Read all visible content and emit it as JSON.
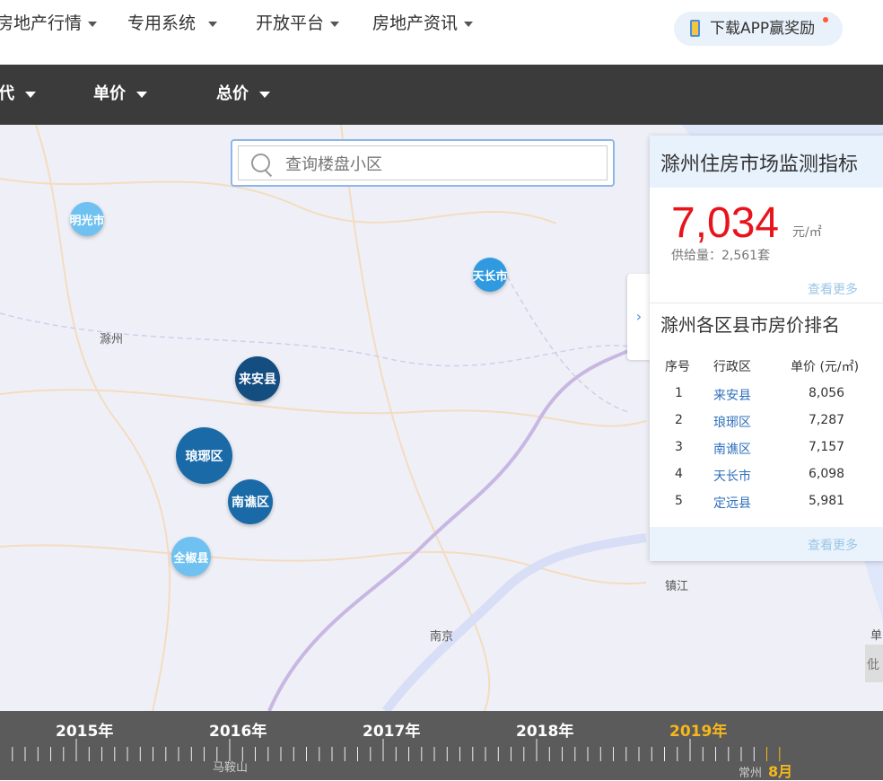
{
  "nav": {
    "items": [
      "房地产行情",
      "专用系统",
      "开放平台",
      "房地产资讯"
    ],
    "app_button": "下载APP赢奖励"
  },
  "filters": [
    "代",
    "单价",
    "总价"
  ],
  "search": {
    "placeholder": "查询楼盘小区"
  },
  "map": {
    "place_labels": [
      "滁州",
      "南京",
      "镇江",
      "马鞍山",
      "常州",
      "单",
      "仳"
    ],
    "bubbles": [
      "明光市",
      "天长市",
      "来安县",
      "琅琊区",
      "南谯区",
      "全椒县"
    ]
  },
  "panel": {
    "title": "滁州住房市场监测指标",
    "price": "7,034",
    "unit": "元/㎡",
    "supply": "供给量：2,561套",
    "more": "查看更多",
    "ranking_title": "滁州各区县市房价排名",
    "columns": [
      "序号",
      "行政区",
      "单价 (元/㎡)"
    ],
    "rows": [
      {
        "rank": "1",
        "district": "来安县",
        "price": "8,056"
      },
      {
        "rank": "2",
        "district": "琅琊区",
        "price": "7,287"
      },
      {
        "rank": "3",
        "district": "南谯区",
        "price": "7,157"
      },
      {
        "rank": "4",
        "district": "天长市",
        "price": "6,098"
      },
      {
        "rank": "5",
        "district": "定远县",
        "price": "5,981"
      }
    ],
    "footer_more": "查看更多"
  },
  "timeline": {
    "years": [
      "2015年",
      "2016年",
      "2017年",
      "2018年",
      "2019年"
    ],
    "active_year": "2019年",
    "month": "8月"
  },
  "colors": {
    "accent_price": "#e8141c",
    "filter_bar": "#3b3b3b",
    "timeline_active": "#f6b81a",
    "bubble_dark": "#1a5e95",
    "bubble_mid": "#2f8fd6",
    "bubble_light": "#6ec1f0"
  }
}
